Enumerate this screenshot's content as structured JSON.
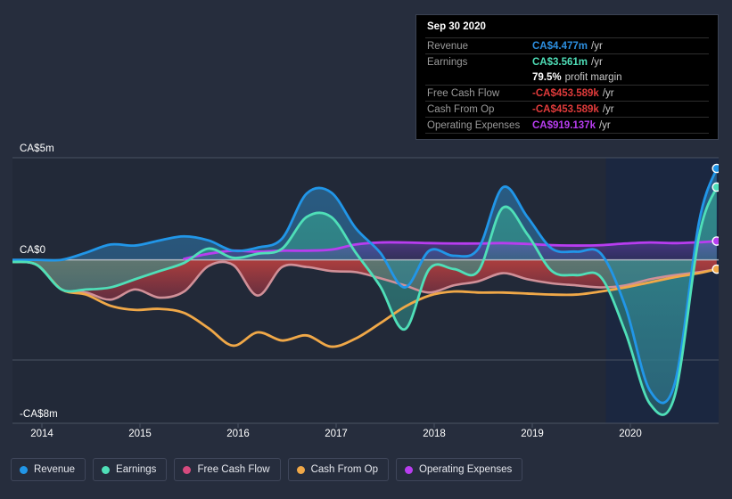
{
  "theme": {
    "background": "#262d3d",
    "plot_background": "#222938",
    "forecast_background": "#1b2740",
    "gridline": "#4a5262",
    "zero_line": "#c9ccd4"
  },
  "axis": {
    "y_labels": [
      {
        "text": "CA$5m",
        "value": 5000000,
        "y": 177
      },
      {
        "text": "CA$0",
        "value": 0,
        "y": 291
      },
      {
        "text": "-CA$8m",
        "value": -8000000,
        "y": 475
      }
    ],
    "x_labels": [
      "2014",
      "2015",
      "2016",
      "2017",
      "2018",
      "2019",
      "2020"
    ]
  },
  "tooltip": {
    "date": "Sep 30 2020",
    "rows": [
      {
        "label": "Revenue",
        "value": "CA$4.477m",
        "unit": "/yr",
        "color": "#2d8fe0"
      },
      {
        "label": "Earnings",
        "value": "CA$3.561m",
        "unit": "/yr",
        "color": "#4fdfb8"
      },
      {
        "label": "",
        "value": "79.5%",
        "unit": "profit margin",
        "color": "#ffffff",
        "sub": true
      },
      {
        "label": "Free Cash Flow",
        "value": "-CA$453.589k",
        "unit": "/yr",
        "color": "#e03b3b"
      },
      {
        "label": "Cash From Op",
        "value": "-CA$453.589k",
        "unit": "/yr",
        "color": "#e03b3b"
      },
      {
        "label": "Operating Expenses",
        "value": "CA$919.137k",
        "unit": "/yr",
        "color": "#b83df0"
      }
    ]
  },
  "legend": {
    "items": [
      {
        "label": "Revenue",
        "color": "#2196e8"
      },
      {
        "label": "Earnings",
        "color": "#4fdfb8"
      },
      {
        "label": "Free Cash Flow",
        "color": "#d64a7e"
      },
      {
        "label": "Cash From Op",
        "color": "#f0a848"
      },
      {
        "label": "Operating Expenses",
        "color": "#b83df0"
      }
    ]
  },
  "chart_data": {
    "type": "area",
    "title": "",
    "xlabel": "",
    "ylabel": "",
    "currency": "CA$",
    "ylim": [
      -8000000,
      5000000
    ],
    "xlim": [
      2013.7,
      2020.9
    ],
    "grid": true,
    "legend_position": "bottom",
    "forecast_start_x": 2019.75,
    "annotation": "Sep 30 2020 highlighted via tooltip",
    "x": [
      2013.7,
      2013.95,
      2014.2,
      2014.45,
      2014.7,
      2014.95,
      2015.2,
      2015.45,
      2015.7,
      2015.95,
      2016.2,
      2016.45,
      2016.7,
      2016.95,
      2017.2,
      2017.45,
      2017.7,
      2017.95,
      2018.2,
      2018.45,
      2018.7,
      2018.95,
      2019.2,
      2019.45,
      2019.7,
      2019.95,
      2020.2,
      2020.45,
      2020.7,
      2020.88
    ],
    "series": [
      {
        "name": "Revenue",
        "color": "#2196e8",
        "fill": "rgba(40,115,175,0.55)",
        "values": [
          0,
          0,
          0,
          0.35,
          0.75,
          0.7,
          0.95,
          1.15,
          0.95,
          0.45,
          0.6,
          1.05,
          3.25,
          3.3,
          1.55,
          0.35,
          -1.35,
          0.45,
          0.2,
          0.55,
          3.55,
          2.1,
          0.55,
          0.4,
          0.3,
          -2.3,
          -6.4,
          -6.1,
          1.85,
          4.477
        ]
      },
      {
        "name": "Earnings",
        "color": "#4fdfb8",
        "fill": "rgba(60,170,155,0.45)",
        "values": [
          -0.1,
          -0.25,
          -1.45,
          -1.45,
          -1.35,
          -0.95,
          -0.55,
          -0.15,
          0.55,
          0.1,
          0.3,
          0.55,
          2.1,
          2.1,
          0.35,
          -1.3,
          -3.4,
          -0.45,
          -0.45,
          -0.55,
          2.55,
          1.25,
          -0.55,
          -0.75,
          -0.85,
          -3.55,
          -7.05,
          -6.7,
          1.15,
          3.561
        ]
      },
      {
        "name": "Free Cash Flow",
        "color": "#d09098",
        "fill": "rgba(170,60,60,0.55)",
        "values": [
          -0.1,
          -0.25,
          -1.45,
          -1.6,
          -1.95,
          -1.45,
          -1.85,
          -1.55,
          -0.3,
          -0.25,
          -1.75,
          -0.35,
          -0.35,
          -0.55,
          -0.6,
          -0.9,
          -1.25,
          -1.6,
          -1.25,
          -1.05,
          -0.65,
          -0.95,
          -1.15,
          -1.25,
          -1.35,
          -1.25,
          -0.95,
          -0.75,
          -0.6,
          -0.454
        ]
      },
      {
        "name": "Cash From Op",
        "color": "#f0a848",
        "fill": "none",
        "values": [
          -0.1,
          -0.25,
          -1.45,
          -1.7,
          -2.25,
          -2.45,
          -2.4,
          -2.6,
          -3.35,
          -4.2,
          -3.55,
          -3.95,
          -3.7,
          -4.25,
          -3.85,
          -3.1,
          -2.3,
          -1.75,
          -1.55,
          -1.6,
          -1.6,
          -1.65,
          -1.7,
          -1.7,
          -1.55,
          -1.35,
          -1.1,
          -0.85,
          -0.65,
          -0.454
        ]
      },
      {
        "name": "Operating Expenses",
        "color": "#b83df0",
        "fill": "rgba(95,60,175,0.42)",
        "values": [
          null,
          null,
          null,
          null,
          null,
          null,
          null,
          0.05,
          0.3,
          0.45,
          0.4,
          0.45,
          0.45,
          0.5,
          0.75,
          0.85,
          0.85,
          0.82,
          0.8,
          0.8,
          0.82,
          0.78,
          0.72,
          0.7,
          0.72,
          0.8,
          0.85,
          0.82,
          0.86,
          0.919
        ]
      }
    ]
  }
}
